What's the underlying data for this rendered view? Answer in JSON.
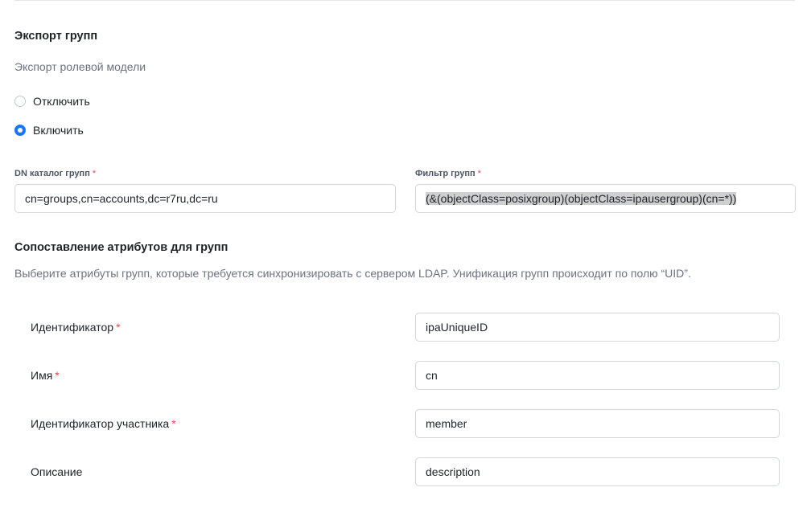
{
  "export": {
    "title": "Экспорт групп",
    "subtitle": "Экспорт ролевой модели",
    "options": [
      {
        "label": "Отключить",
        "checked": false
      },
      {
        "label": "Включить",
        "checked": true
      }
    ]
  },
  "fields": {
    "dn": {
      "label": "DN каталог групп",
      "required_mark": "*",
      "value": "cn=groups,cn=accounts,dc=r7ru,dc=ru"
    },
    "filter": {
      "label": "Фильтр групп",
      "required_mark": "*",
      "value": "(&(objectClass=posixgroup)(objectClass=ipausergroup)(cn=*))"
    }
  },
  "mapping": {
    "title": "Сопоставление атрибутов для групп",
    "description": "Выберите атрибуты групп, которые требуется синхронизировать с сервером LDAP. Унификация групп происходит по полю “UID”.",
    "rows": [
      {
        "label": "Идентификатор",
        "required_mark": "*",
        "value": "ipaUniqueID"
      },
      {
        "label": "Имя",
        "required_mark": "*",
        "value": "cn"
      },
      {
        "label": "Идентификатор участника",
        "required_mark": "*",
        "value": "member"
      },
      {
        "label": "Описание",
        "required_mark": "",
        "value": "description"
      }
    ]
  },
  "colors": {
    "accent": "#1677ff",
    "required": "#e5484d",
    "border": "#d3d7dc"
  }
}
